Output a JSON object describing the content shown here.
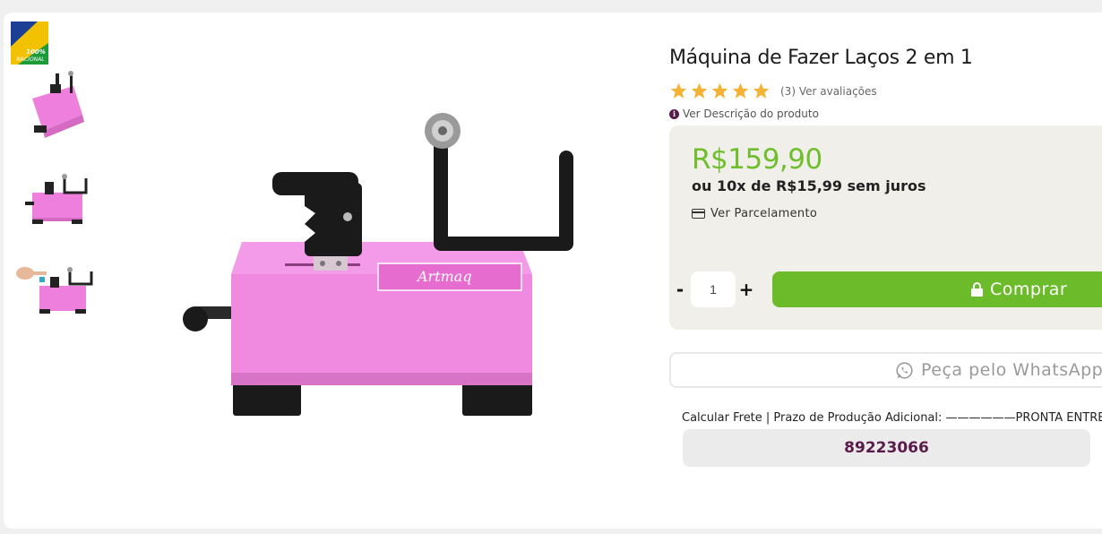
{
  "badge": {
    "text1": "100%",
    "text2": "NACIONAL"
  },
  "thumbnails": [
    {
      "name": "thumbnail-1"
    },
    {
      "name": "thumbnail-2"
    },
    {
      "name": "thumbnail-3"
    }
  ],
  "product": {
    "title": "Máquina de Fazer Laços 2 em 1",
    "rating": 5,
    "rating_count": "(3)",
    "rating_link": "Ver avaliações",
    "description_link": "Ver Descrição do produto",
    "image_brand": "Artmaq"
  },
  "pricing": {
    "price": "R$159,90",
    "installments": "ou 10x de R$15,99 sem juros",
    "parcel_link": "Ver Parcelamento"
  },
  "purchase": {
    "minus_label": "-",
    "quantity": "1",
    "plus_label": "+",
    "buy_label": "Comprar",
    "whatsapp_label": "Peça pelo WhatsApp"
  },
  "shipping": {
    "text": "Calcular Frete  |  Prazo de Produção Adicional: ——————PRONTA ENTREGA",
    "cep_value": "89223066"
  },
  "colors": {
    "price_green": "#6fbe2d",
    "buy_green": "#6cbb2a",
    "accent_purple": "#5a1a4a",
    "machine_pink": "#f08ae0"
  }
}
